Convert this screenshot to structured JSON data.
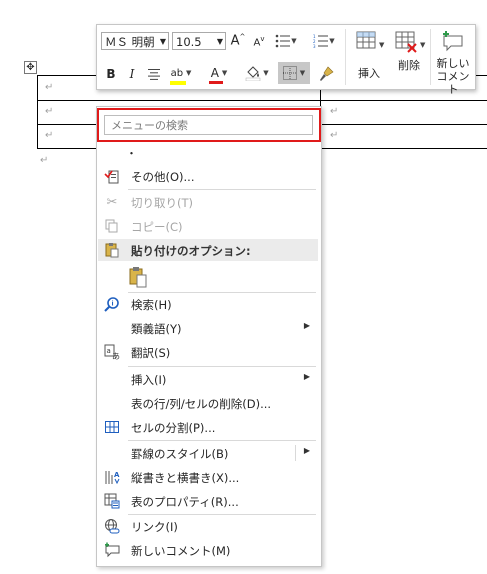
{
  "toolbar": {
    "font_name": "ＭＳ 明朝",
    "font_size": "10.5",
    "insert_label": "挿入",
    "delete_label": "削除",
    "new_comment_label_line1": "新しい",
    "new_comment_label_line2": "コメント",
    "bold_glyph": "B",
    "italic_glyph": "I",
    "font_color_glyph": "A",
    "grow_font_glyph": "A",
    "shrink_font_glyph": "A",
    "highlight_glyph": "ab",
    "accent_red": "#e01a1a",
    "highlight_yellow": "#ffff00"
  },
  "document": {
    "paragraph_mark": "↵"
  },
  "menu": {
    "search_placeholder": "メニューの検索",
    "dot": "・",
    "items": [
      {
        "label": "その他(O)...",
        "icon": "more-options-icon",
        "enabled": true
      },
      {
        "label": "切り取り(T)",
        "icon": "scissors-icon",
        "enabled": false
      },
      {
        "label": "コピー(C)",
        "icon": "copy-icon",
        "enabled": false
      },
      {
        "label": "貼り付けのオプション:",
        "icon": "paste-icon",
        "enabled": true
      },
      {
        "label": "検索(H)",
        "icon": "search-icon",
        "enabled": true
      },
      {
        "label": "類義語(Y)",
        "icon": "",
        "enabled": true
      },
      {
        "label": "翻訳(S)",
        "icon": "translate-icon",
        "enabled": true
      },
      {
        "label": "挿入(I)",
        "icon": "",
        "enabled": true
      },
      {
        "label": "表の行/列/セルの削除(D)...",
        "icon": "",
        "enabled": true
      },
      {
        "label": "セルの分割(P)...",
        "icon": "split-cells-icon",
        "enabled": true
      },
      {
        "label": "罫線のスタイル(B)",
        "icon": "",
        "enabled": true
      },
      {
        "label": "縦書きと横書き(X)...",
        "icon": "text-direction-icon",
        "enabled": true
      },
      {
        "label": "表のプロパティ(R)...",
        "icon": "table-properties-icon",
        "enabled": true
      },
      {
        "label": "リンク(I)",
        "icon": "link-icon",
        "enabled": true
      },
      {
        "label": "新しいコメント(M)",
        "icon": "new-comment-icon",
        "enabled": true
      }
    ],
    "submenu_arrow": "▶"
  }
}
